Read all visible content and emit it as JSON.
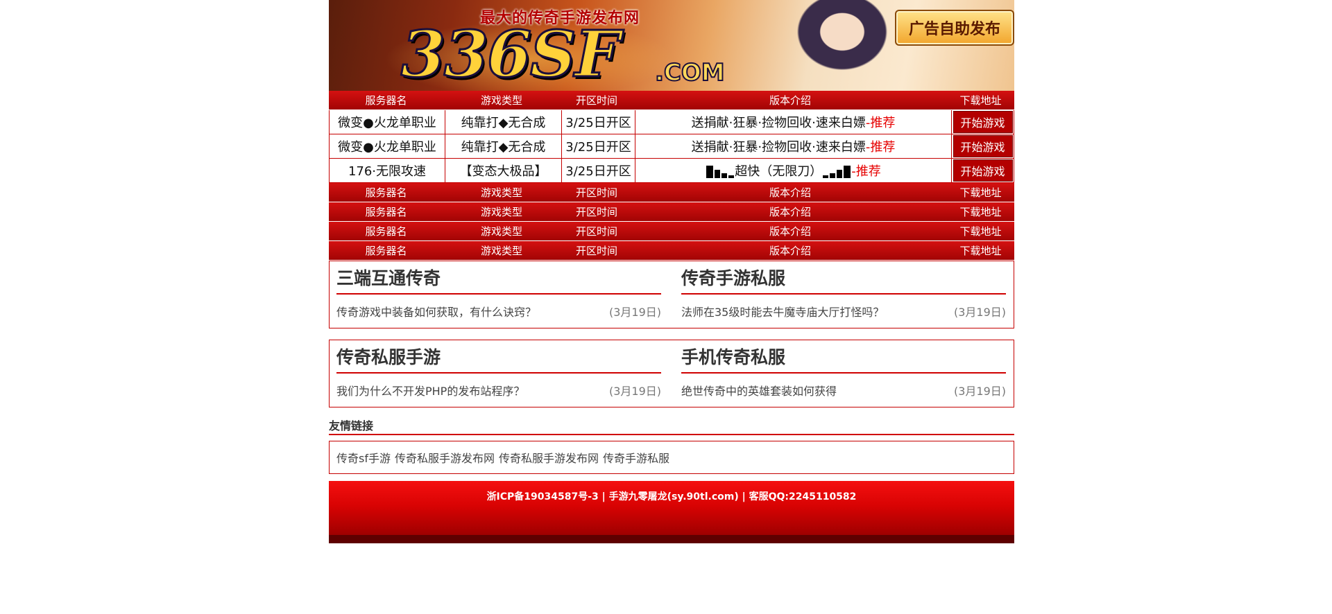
{
  "banner": {
    "slogan": "最大的传奇手游发布网",
    "logo": "336SF",
    "logo_suffix": ".COM",
    "ad_button": "广告自助发布"
  },
  "columns": {
    "server": "服务器名",
    "type": "游戏类型",
    "open": "开区时间",
    "intro": "版本介绍",
    "download": "下载地址"
  },
  "rows": [
    {
      "server": "微变●火龙单职业",
      "type": "纯靠打◆无合成",
      "open": "3/25日开区",
      "intro": "送捐献·狂暴·捡物回收·速来白嫖",
      "tag": "-推荐",
      "button": "开始游戏"
    },
    {
      "server": "微变●火龙单职业",
      "type": "纯靠打◆无合成",
      "open": "3/25日开区",
      "intro": "送捐献·狂暴·捡物回收·速来白嫖",
      "tag": "-推荐",
      "button": "开始游戏"
    },
    {
      "server": "176·无限攻速",
      "type": "【变态大极品】",
      "open": "3/25日开区",
      "intro": "超快（无限刀）",
      "tag": "-推荐",
      "button": "开始游戏"
    }
  ],
  "news": [
    {
      "title": "三端互通传奇",
      "item": "传奇游戏中装备如何获取，有什么诀窍？",
      "date": "(3月19日)"
    },
    {
      "title": "传奇手游私服",
      "item": "法师在35级时能去牛魔寺庙大厅打怪吗？",
      "date": "(3月19日)"
    },
    {
      "title": "传奇私服手游",
      "item": "我们为什么不开发PHP的发布站程序？",
      "date": "(3月19日)"
    },
    {
      "title": "手机传奇私服",
      "item": "绝世传奇中的英雄套装如何获得",
      "date": "(3月19日)"
    }
  ],
  "links": {
    "title": "友情链接",
    "items": [
      "传奇sf手游",
      "传奇私服手游发布网",
      "传奇私服手游发布网",
      "传奇手游私服"
    ]
  },
  "footer": {
    "text": "浙ICP备19034587号-3 | 手游九零屠龙(sy.90tl.com) | 客服QQ:2245110582"
  },
  "colors": {
    "accent": "#c50000",
    "header_red": "#b30000",
    "recommend": "#e60000"
  }
}
